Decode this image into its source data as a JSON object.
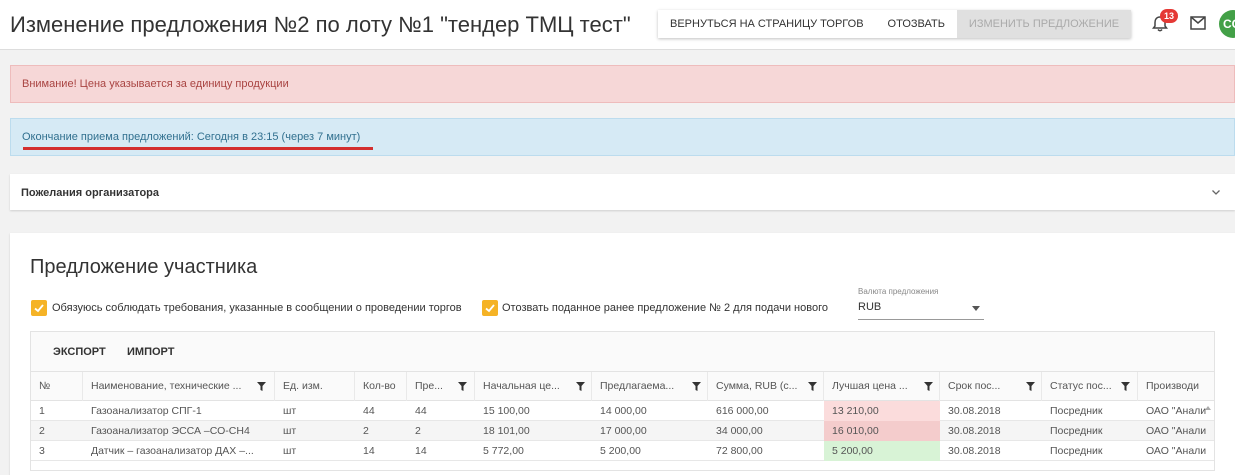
{
  "header": {
    "title": "Изменение предложения №2 по лоту №1 \"тендер ТМЦ тест\"",
    "buttons": {
      "back": "ВЕРНУТЬСЯ НА СТРАНИЦУ ТОРГОВ",
      "revoke": "ОТОЗВАТЬ",
      "change": "ИЗМЕНИТЬ ПРЕДЛОЖЕНИЕ"
    },
    "notifications_count": "13",
    "avatar_initials": "СС"
  },
  "alerts": {
    "warning": "Внимание! Цена указывается за единицу продукции",
    "deadline": "Окончание приема предложений: Сегодня в 23:15 (через 7 минут)"
  },
  "wishes": {
    "title": "Пожелания организатора"
  },
  "proposal": {
    "title": "Предложение участника",
    "checkbox1_label": "Обязуюсь соблюдать требования, указанные в сообщении о проведении торгов",
    "checkbox2_label": "Отозвать поданное ранее предложение № 2 для подачи нового",
    "currency_label": "Валюта предложения",
    "currency_value": "RUB",
    "toolbar": {
      "export": "ЭКСПОРТ",
      "import": "ИМПОРТ"
    },
    "columns": [
      "№",
      "Наименование, технические ...",
      "Ед. изм.",
      "Кол-во",
      "Пре...",
      "Начальная це...",
      "Предлагаема...",
      "Сумма, RUB (с...",
      "Лучшая цена ...",
      "Срок пос...",
      "Статус пос...",
      "Производи"
    ],
    "rows": [
      [
        "1",
        "Газоанализатор СПГ-1",
        "шт",
        "44",
        "44",
        "15 100,00",
        "14 000,00",
        "616 000,00",
        "13 210,00",
        "30.08.2018",
        "Посредник",
        "ОАО \"Анали"
      ],
      [
        "2",
        "Газоанализатор ЭССА –СО-СН4",
        "шт",
        "2",
        "2",
        "18 101,00",
        "17 000,00",
        "34 000,00",
        "16 010,00",
        "30.08.2018",
        "Посредник",
        "ОАО \"Анали"
      ],
      [
        "3",
        "Датчик – газоанализатор ДАХ –...",
        "шт",
        "14",
        "14",
        "5 772,00",
        "5 200,00",
        "72 800,00",
        "5 200,00",
        "30.08.2018",
        "Посредник",
        "ОАО \"Анали"
      ]
    ]
  },
  "colors": {
    "checkbox": "#f5b326",
    "badge": "#e53935",
    "avatar": "#43a047",
    "warning_bg": "#f6d7d7",
    "info_bg": "#d6eaf5",
    "best_worse": "#fbdcdc",
    "best_match": "#d8f3d6"
  }
}
